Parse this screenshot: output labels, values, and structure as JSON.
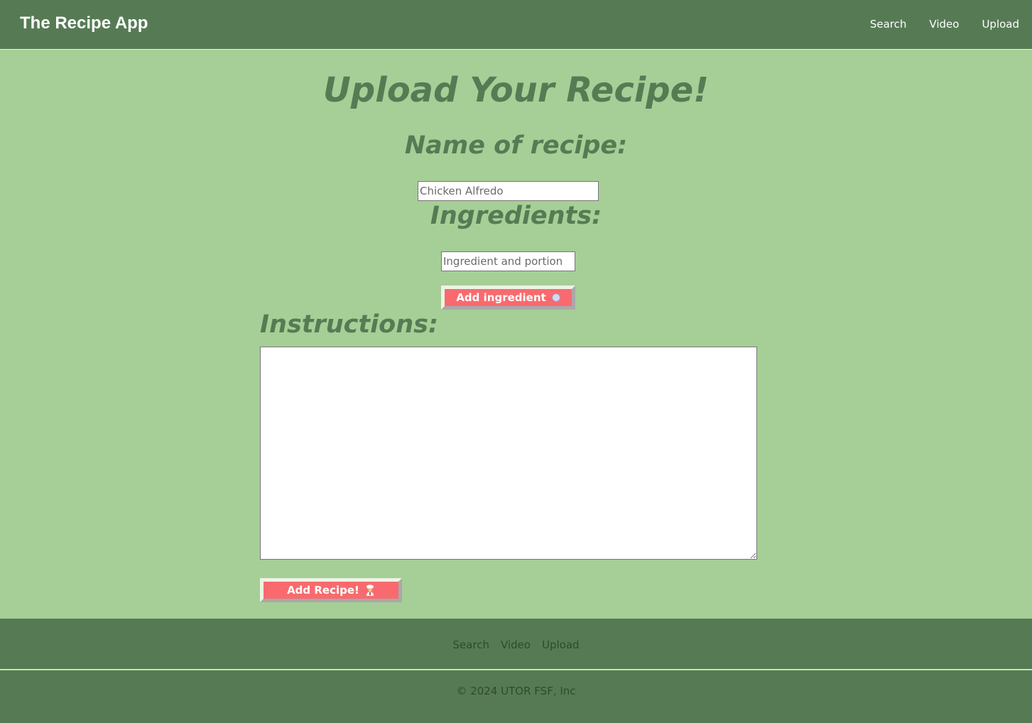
{
  "header": {
    "brand": "The Recipe App",
    "nav": [
      "Search",
      "Video",
      "Upload"
    ]
  },
  "main": {
    "title": "Upload Your Recipe!",
    "name_label": "Name of recipe:",
    "name_placeholder": "Chicken Alfredo",
    "ingredients_label": "Ingredients:",
    "ingredient_placeholder": "Ingredient and portion",
    "add_ingredient_label": "Add ingredient",
    "instructions_label": "Instructions:",
    "instructions_value": "",
    "add_recipe_label": "Add Recipe!"
  },
  "footer": {
    "links": [
      "Search",
      "Video",
      "Upload"
    ],
    "copyright": "© 2024 UTOR FSF, Inc"
  },
  "colors": {
    "header_bg": "#567b54",
    "page_bg": "#a5cf96",
    "button_bg": "#f96a6e",
    "heading": "#567b54"
  },
  "icons": {
    "add_ingredient": "circle-dot-icon",
    "add_recipe": "chef-icon"
  }
}
